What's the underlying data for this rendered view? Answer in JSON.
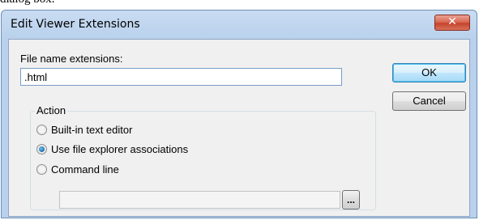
{
  "caption": "dialog box.",
  "dialog": {
    "title": "Edit Viewer Extensions",
    "close_label": "✕"
  },
  "extensions": {
    "label": "File name extensions:",
    "value": ".html"
  },
  "buttons": {
    "ok": "OK",
    "cancel": "Cancel",
    "browse": "..."
  },
  "action": {
    "legend": "Action",
    "options": [
      {
        "label": "Built-in text editor",
        "checked": false
      },
      {
        "label": "Use file explorer associations",
        "checked": true
      },
      {
        "label": "Command line",
        "checked": false
      }
    ],
    "command_line_value": ""
  }
}
